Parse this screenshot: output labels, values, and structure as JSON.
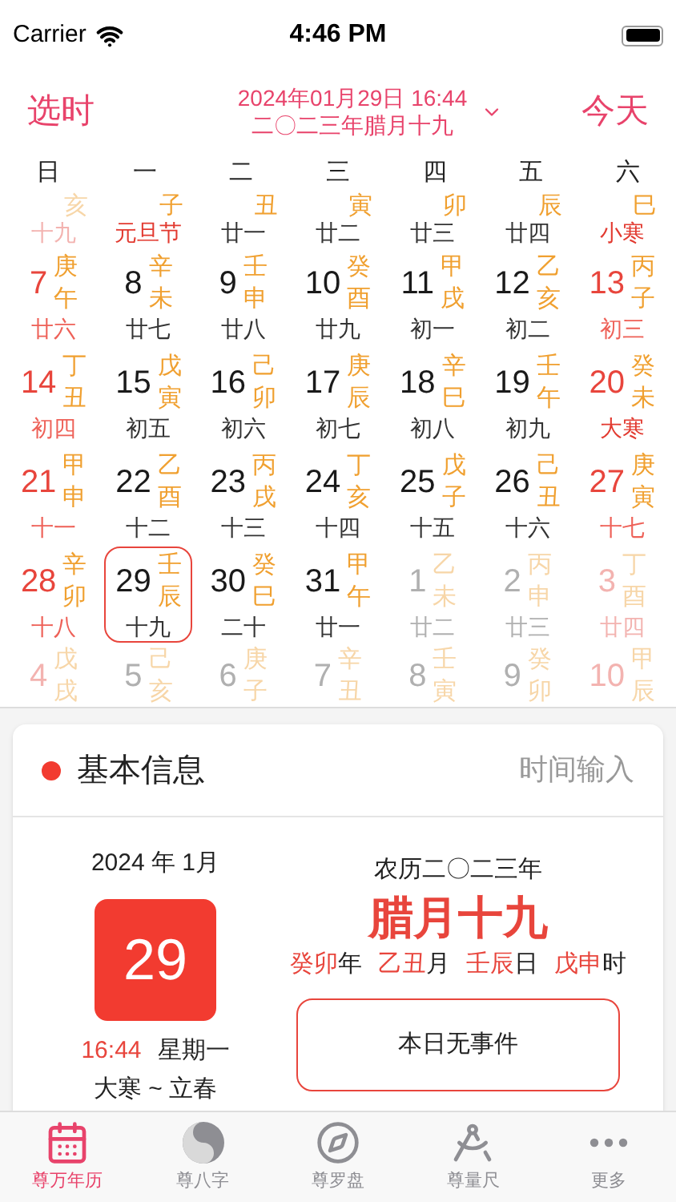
{
  "status_bar": {
    "carrier": "Carrier",
    "time": "4:46 PM"
  },
  "header": {
    "left": "选时",
    "date": "2024年01月29日 16:44",
    "lunar": "二〇二三年腊月十九",
    "right": "今天"
  },
  "weekdays": [
    "日",
    "一",
    "二",
    "三",
    "四",
    "五",
    "六"
  ],
  "top_row": [
    {
      "branch": "亥",
      "lunar": "十九",
      "kind": "dim_weekend",
      "festival": false
    },
    {
      "branch": "子",
      "lunar": "元旦节",
      "kind": "normal",
      "festival": true
    },
    {
      "branch": "丑",
      "lunar": "廿一",
      "kind": "normal",
      "festival": false
    },
    {
      "branch": "寅",
      "lunar": "廿二",
      "kind": "normal",
      "festival": false
    },
    {
      "branch": "卯",
      "lunar": "廿三",
      "kind": "normal",
      "festival": false
    },
    {
      "branch": "辰",
      "lunar": "廿四",
      "kind": "normal",
      "festival": false
    },
    {
      "branch": "巳",
      "lunar": "小寒",
      "kind": "weekend",
      "festival": true
    }
  ],
  "weeks": [
    [
      {
        "day": "7",
        "stem": "庚",
        "branch": "午",
        "lunar": "廿六",
        "kind": "weekend",
        "festival": false,
        "selected": false
      },
      {
        "day": "8",
        "stem": "辛",
        "branch": "未",
        "lunar": "廿七",
        "kind": "normal",
        "festival": false,
        "selected": false
      },
      {
        "day": "9",
        "stem": "壬",
        "branch": "申",
        "lunar": "廿八",
        "kind": "normal",
        "festival": false,
        "selected": false
      },
      {
        "day": "10",
        "stem": "癸",
        "branch": "酉",
        "lunar": "廿九",
        "kind": "normal",
        "festival": false,
        "selected": false
      },
      {
        "day": "11",
        "stem": "甲",
        "branch": "戌",
        "lunar": "初一",
        "kind": "normal",
        "festival": false,
        "selected": false
      },
      {
        "day": "12",
        "stem": "乙",
        "branch": "亥",
        "lunar": "初二",
        "kind": "normal",
        "festival": false,
        "selected": false
      },
      {
        "day": "13",
        "stem": "丙",
        "branch": "子",
        "lunar": "初三",
        "kind": "weekend",
        "festival": false,
        "selected": false
      }
    ],
    [
      {
        "day": "14",
        "stem": "丁",
        "branch": "丑",
        "lunar": "初四",
        "kind": "weekend",
        "festival": false,
        "selected": false
      },
      {
        "day": "15",
        "stem": "戊",
        "branch": "寅",
        "lunar": "初五",
        "kind": "normal",
        "festival": false,
        "selected": false
      },
      {
        "day": "16",
        "stem": "己",
        "branch": "卯",
        "lunar": "初六",
        "kind": "normal",
        "festival": false,
        "selected": false
      },
      {
        "day": "17",
        "stem": "庚",
        "branch": "辰",
        "lunar": "初七",
        "kind": "normal",
        "festival": false,
        "selected": false
      },
      {
        "day": "18",
        "stem": "辛",
        "branch": "巳",
        "lunar": "初八",
        "kind": "normal",
        "festival": false,
        "selected": false
      },
      {
        "day": "19",
        "stem": "壬",
        "branch": "午",
        "lunar": "初九",
        "kind": "normal",
        "festival": false,
        "selected": false
      },
      {
        "day": "20",
        "stem": "癸",
        "branch": "未",
        "lunar": "大寒",
        "kind": "weekend",
        "festival": true,
        "selected": false
      }
    ],
    [
      {
        "day": "21",
        "stem": "甲",
        "branch": "申",
        "lunar": "十一",
        "kind": "weekend",
        "festival": false,
        "selected": false
      },
      {
        "day": "22",
        "stem": "乙",
        "branch": "酉",
        "lunar": "十二",
        "kind": "normal",
        "festival": false,
        "selected": false
      },
      {
        "day": "23",
        "stem": "丙",
        "branch": "戌",
        "lunar": "十三",
        "kind": "normal",
        "festival": false,
        "selected": false
      },
      {
        "day": "24",
        "stem": "丁",
        "branch": "亥",
        "lunar": "十四",
        "kind": "normal",
        "festival": false,
        "selected": false
      },
      {
        "day": "25",
        "stem": "戊",
        "branch": "子",
        "lunar": "十五",
        "kind": "normal",
        "festival": false,
        "selected": false
      },
      {
        "day": "26",
        "stem": "己",
        "branch": "丑",
        "lunar": "十六",
        "kind": "normal",
        "festival": false,
        "selected": false
      },
      {
        "day": "27",
        "stem": "庚",
        "branch": "寅",
        "lunar": "十七",
        "kind": "weekend",
        "festival": false,
        "selected": false
      }
    ],
    [
      {
        "day": "28",
        "stem": "辛",
        "branch": "卯",
        "lunar": "十八",
        "kind": "weekend",
        "festival": false,
        "selected": false
      },
      {
        "day": "29",
        "stem": "壬",
        "branch": "辰",
        "lunar": "十九",
        "kind": "normal",
        "festival": false,
        "selected": true
      },
      {
        "day": "30",
        "stem": "癸",
        "branch": "巳",
        "lunar": "二十",
        "kind": "normal",
        "festival": false,
        "selected": false
      },
      {
        "day": "31",
        "stem": "甲",
        "branch": "午",
        "lunar": "廿一",
        "kind": "normal",
        "festival": false,
        "selected": false
      },
      {
        "day": "1",
        "stem": "乙",
        "branch": "未",
        "lunar": "廿二",
        "kind": "dim",
        "festival": false,
        "selected": false
      },
      {
        "day": "2",
        "stem": "丙",
        "branch": "申",
        "lunar": "廿三",
        "kind": "dim",
        "festival": false,
        "selected": false
      },
      {
        "day": "3",
        "stem": "丁",
        "branch": "酉",
        "lunar": "廿四",
        "kind": "dim_weekend",
        "festival": false,
        "selected": false
      }
    ]
  ],
  "bottom_row": [
    {
      "day": "4",
      "stem": "戊",
      "branch": "戌",
      "kind": "dim_weekend"
    },
    {
      "day": "5",
      "stem": "己",
      "branch": "亥",
      "kind": "dim"
    },
    {
      "day": "6",
      "stem": "庚",
      "branch": "子",
      "kind": "dim"
    },
    {
      "day": "7",
      "stem": "辛",
      "branch": "丑",
      "kind": "dim"
    },
    {
      "day": "8",
      "stem": "壬",
      "branch": "寅",
      "kind": "dim"
    },
    {
      "day": "9",
      "stem": "癸",
      "branch": "卯",
      "kind": "dim"
    },
    {
      "day": "10",
      "stem": "甲",
      "branch": "辰",
      "kind": "dim_weekend"
    }
  ],
  "info_card": {
    "title": "基本信息",
    "action": "时间输入",
    "month": "2024 年 1月",
    "day": "29",
    "time": "16:44",
    "weekday": "星期一",
    "term": "大寒 ~ 立春",
    "lunar_year": "农历二〇二三年",
    "lunar_date": "腊月十九",
    "pillars": [
      {
        "ganzhi": "癸卯",
        "unit": "年"
      },
      {
        "ganzhi": "乙丑",
        "unit": "月"
      },
      {
        "ganzhi": "壬辰",
        "unit": "日"
      },
      {
        "ganzhi": "戊申",
        "unit": "时"
      }
    ],
    "events": "本日无事件"
  },
  "tab_bar": [
    {
      "kind": "calendar",
      "label": "尊万年历",
      "selected": true
    },
    {
      "kind": "yinyang",
      "label": "尊八字",
      "selected": false
    },
    {
      "kind": "compass",
      "label": "尊罗盘",
      "selected": false
    },
    {
      "kind": "ruler",
      "label": "尊量尺",
      "selected": false
    },
    {
      "kind": "more",
      "label": "更多",
      "selected": false
    }
  ]
}
